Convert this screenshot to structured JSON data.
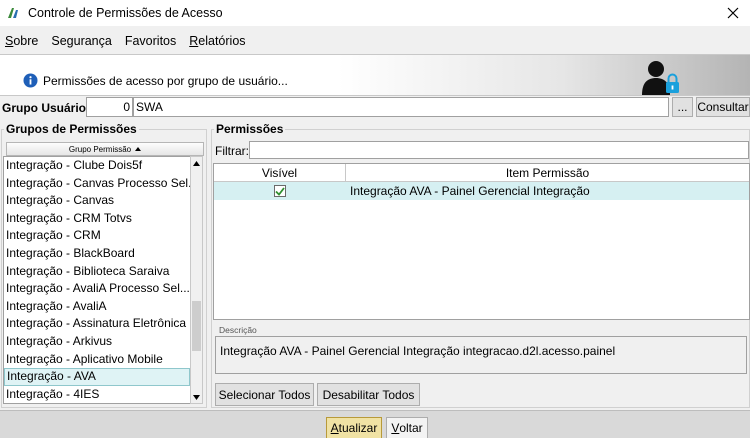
{
  "window": {
    "title": "Controle de Permissões de Acesso"
  },
  "menu": [
    {
      "label": "Sobre",
      "accel": "S",
      "rest": "obre"
    },
    {
      "label": "Segurança",
      "accel": "",
      "rest": "Segurança"
    },
    {
      "label": "Favoritos",
      "accel": "",
      "rest": "Favoritos"
    },
    {
      "label": "Relatórios",
      "accel": "R",
      "rest": "elatórios"
    }
  ],
  "banner": {
    "text": "Permissões de acesso por grupo de usuário..."
  },
  "grupo_usuario": {
    "label": "Grupo Usuário:",
    "code": "0",
    "name": "SWA",
    "ellipsis_label": "...",
    "consultar_label": "Consultar"
  },
  "grupos_permissoes": {
    "title": "Grupos de Permissões",
    "column_header": "Grupo Permissão",
    "items": [
      "Integração - Clube Dois5f",
      "Integração - Canvas Processo Sel...",
      "Integração - Canvas",
      "Integração - CRM Totvs",
      "Integração - CRM",
      "Integração - BlackBoard",
      "Integração - Biblioteca Saraiva",
      "Integração - AvaliA Processo Sel...",
      "Integração - AvaliA",
      "Integração - Assinatura Eletrônica",
      "Integração - Arkivus",
      "Integração - Aplicativo Mobile",
      "Integração - AVA",
      "Integração - 4IES"
    ],
    "selected_item": "Integração - AVA"
  },
  "permissoes": {
    "title": "Permissões",
    "filter_label": "Filtrar:",
    "filter_value": "",
    "columns": [
      "Visível",
      "Item Permissão"
    ],
    "rows": [
      {
        "visivel": true,
        "item": "Integração AVA - Painel Gerencial Integração"
      }
    ],
    "descricao_label": "Descrição",
    "descricao_text": "Integração AVA - Painel Gerencial Integração integracao.d2l.acesso.painel",
    "selecionar_todos_label": "Selecionar Todos",
    "desabilitar_todos_label": "Desabilitar Todos"
  },
  "footer": {
    "atualizar": {
      "accel": "A",
      "rest": "tualizar"
    },
    "voltar": {
      "accel": "V",
      "rest": "oltar"
    }
  },
  "colors": {
    "selected_row": "#d6f0f2",
    "primary_button": "#f0e2a4"
  }
}
